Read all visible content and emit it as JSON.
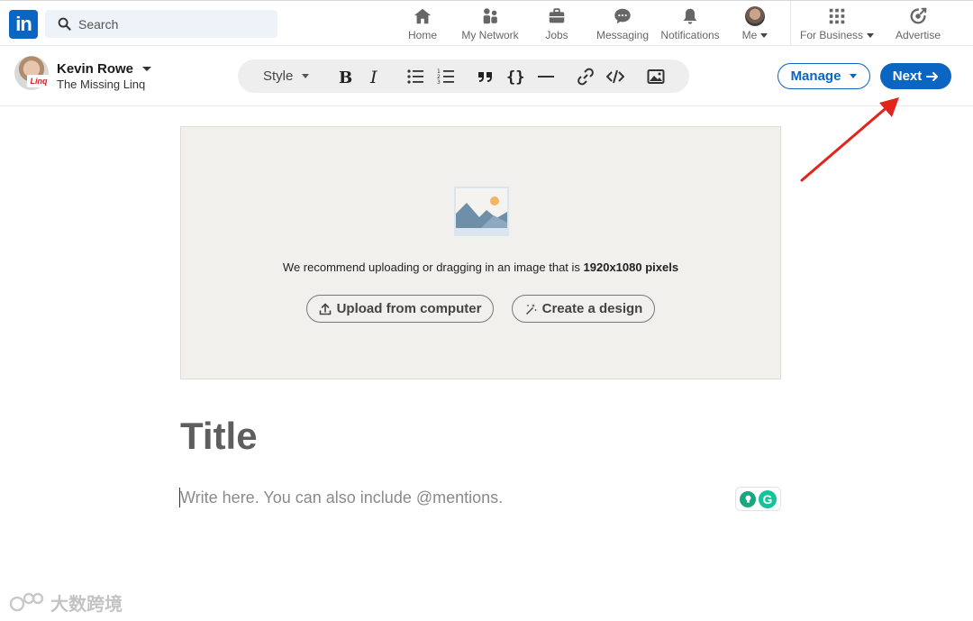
{
  "topnav": {
    "logo_text": "in",
    "search_placeholder": "Search",
    "items": [
      {
        "key": "home",
        "label": "Home",
        "icon": "home-icon"
      },
      {
        "key": "network",
        "label": "My Network",
        "icon": "people-icon"
      },
      {
        "key": "jobs",
        "label": "Jobs",
        "icon": "briefcase-icon"
      },
      {
        "key": "messaging",
        "label": "Messaging",
        "icon": "chat-icon"
      },
      {
        "key": "notifications",
        "label": "Notifications",
        "icon": "bell-icon"
      },
      {
        "key": "me",
        "label": "Me",
        "icon": "avatar"
      },
      {
        "key": "business",
        "label": "For Business",
        "icon": "grid-icon"
      },
      {
        "key": "advertise",
        "label": "Advertise",
        "icon": "advertise-icon"
      }
    ]
  },
  "author": {
    "name": "Kevin Rowe",
    "page": "The Missing Linq",
    "badge": "Linq"
  },
  "toolbar": {
    "style_label": "Style"
  },
  "actions": {
    "manage_label": "Manage",
    "next_label": "Next"
  },
  "cover": {
    "recommend_text": "We recommend uploading or dragging in an image that is ",
    "recommend_size": "1920x1080 pixels",
    "upload_label": "Upload from computer",
    "design_label": "Create a design"
  },
  "article": {
    "title_placeholder": "Title",
    "body_placeholder": "Write here. You can also include @mentions."
  },
  "watermark": {
    "text": "大数跨境"
  },
  "colors": {
    "brand": "#0a66c2",
    "annotation": "#e0261b"
  }
}
